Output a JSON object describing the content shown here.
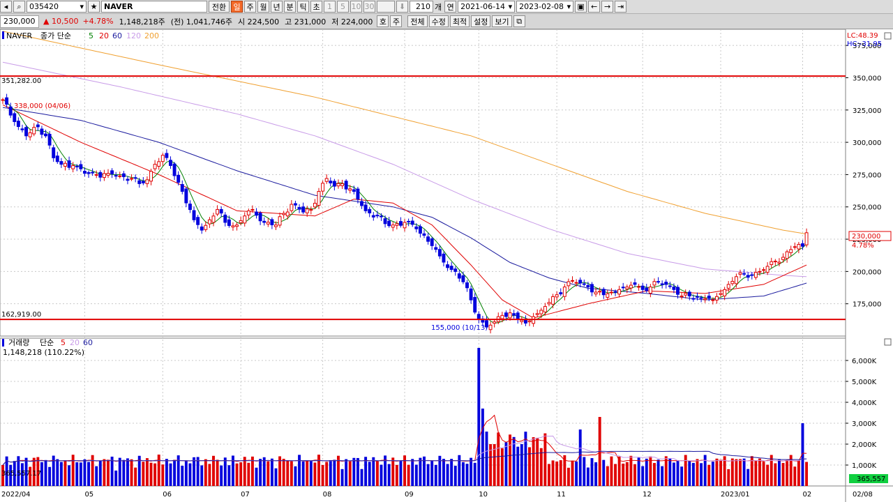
{
  "toolbar": {
    "code": "035420",
    "name": "NAVER",
    "convert_label": "전환",
    "periods": [
      "일",
      "주",
      "월",
      "년",
      "분",
      "틱",
      "초"
    ],
    "active_period": "일",
    "intervals": [
      "1",
      "5",
      "10",
      "30"
    ],
    "count": "210",
    "count_unit": "개",
    "year_label": "연",
    "start_date": "2021-06-14",
    "end_date": "2023-02-08"
  },
  "quote": {
    "price": "230,000",
    "change": "▲ 10,500",
    "change_pct": "+4.78%",
    "volume": "1,148,218주",
    "prev_volume": "(전) 1,041,746주",
    "open": "시 224,500",
    "high": "고 231,000",
    "low": "저 224,000",
    "buttons": [
      "호",
      "주",
      "전체",
      "수정",
      "최적",
      "설정",
      "보기"
    ]
  },
  "colors": {
    "up": "#e00000",
    "down": "#0000dd",
    "ma5": "#008000",
    "ma20": "#e00000",
    "ma60": "#1a1a9e",
    "ma120": "#c89be8",
    "ma200": "#f0a030",
    "hline": "#e00000"
  },
  "price_legend": {
    "name": "NAVER",
    "series": "종가 단순",
    "periods": [
      "5",
      "20",
      "60",
      "120",
      "200"
    ]
  },
  "price_info": {
    "lc": "LC:48.39",
    "hc": "HC:-31.95",
    "hline_high": "351,282.00",
    "hline_low": "162,919.00",
    "high_mark": "338,000 (04/06)",
    "low_mark": "155,000 (10/13)",
    "last_price": "230,000",
    "last_pct": "4.78%",
    "hline_high_value": 351282,
    "hline_low_value": 162919
  },
  "vol_legend": {
    "name": "거래량",
    "series": "단순",
    "periods": [
      "5",
      "20",
      "60"
    ],
    "value": "1,148,218 (110.22%)",
    "left_mark": "365,557.17",
    "last_volume": "365,557"
  },
  "chart_data": {
    "type": "candlestick",
    "price_axis": {
      "min": 150000,
      "max": 387500,
      "ticks": [
        375000,
        350000,
        325000,
        300000,
        275000,
        250000,
        225000,
        200000,
        175000
      ],
      "tick_labels": [
        "375,000",
        "350,000",
        "325,000",
        "300,000",
        "275,000",
        "250,000",
        "225,000",
        "200,000",
        "175,000"
      ]
    },
    "volume_axis": {
      "min": 0,
      "max": 6800000,
      "ticks": [
        6000000,
        5000000,
        4000000,
        3000000,
        2000000,
        1000000
      ],
      "tick_labels": [
        "6,000K",
        "5,000K",
        "4,000K",
        "3,000K",
        "2,000K",
        "1,000K"
      ]
    },
    "x_labels": [
      "2022/04",
      "05",
      "06",
      "07",
      "08",
      "09",
      "10",
      "11",
      "12",
      "2023/01",
      "02",
      "02/08"
    ],
    "x_label_days": [
      0,
      21,
      41,
      61,
      82,
      103,
      122,
      142,
      164,
      184,
      205,
      214
    ],
    "keypoints": [
      [
        0,
        333000
      ],
      [
        3,
        316000
      ],
      [
        6,
        305000
      ],
      [
        9,
        312000
      ],
      [
        11,
        305000
      ],
      [
        13,
        288000
      ],
      [
        15,
        283000
      ],
      [
        18,
        282000
      ],
      [
        21,
        276000
      ],
      [
        24,
        275000
      ],
      [
        27,
        276000
      ],
      [
        30,
        274000
      ],
      [
        33,
        272000
      ],
      [
        35,
        268000
      ],
      [
        37,
        271000
      ],
      [
        39,
        283000
      ],
      [
        41,
        290000
      ],
      [
        43,
        282000
      ],
      [
        46,
        262000
      ],
      [
        49,
        240000
      ],
      [
        51,
        232000
      ],
      [
        53,
        240000
      ],
      [
        55,
        248000
      ],
      [
        57,
        238000
      ],
      [
        60,
        236000
      ],
      [
        62,
        243000
      ],
      [
        64,
        248000
      ],
      [
        67,
        238000
      ],
      [
        70,
        236000
      ],
      [
        72,
        245000
      ],
      [
        74,
        252000
      ],
      [
        77,
        246000
      ],
      [
        79,
        248000
      ],
      [
        81,
        262000
      ],
      [
        83,
        272000
      ],
      [
        85,
        266000
      ],
      [
        87,
        268000
      ],
      [
        89,
        264000
      ],
      [
        91,
        256000
      ],
      [
        93,
        247000
      ],
      [
        96,
        243000
      ],
      [
        98,
        237000
      ],
      [
        100,
        236000
      ],
      [
        103,
        238000
      ],
      [
        106,
        233000
      ],
      [
        108,
        228000
      ],
      [
        110,
        220000
      ],
      [
        112,
        212000
      ],
      [
        114,
        203000
      ],
      [
        116,
        200000
      ],
      [
        118,
        192000
      ],
      [
        120,
        178000
      ],
      [
        122,
        163000
      ],
      [
        124,
        157000
      ],
      [
        126,
        161000
      ],
      [
        128,
        166000
      ],
      [
        130,
        168000
      ],
      [
        132,
        163000
      ],
      [
        134,
        160000
      ],
      [
        136,
        165000
      ],
      [
        138,
        170000
      ],
      [
        140,
        176000
      ],
      [
        142,
        182000
      ],
      [
        144,
        188000
      ],
      [
        146,
        193000
      ],
      [
        148,
        191000
      ],
      [
        150,
        188000
      ],
      [
        152,
        184000
      ],
      [
        154,
        182000
      ],
      [
        156,
        184000
      ],
      [
        158,
        186000
      ],
      [
        160,
        188000
      ],
      [
        162,
        190000
      ],
      [
        164,
        186000
      ],
      [
        166,
        188000
      ],
      [
        168,
        192000
      ],
      [
        170,
        190000
      ],
      [
        172,
        186000
      ],
      [
        174,
        181000
      ],
      [
        176,
        181000
      ],
      [
        178,
        180000
      ],
      [
        180,
        179000
      ],
      [
        182,
        178000
      ],
      [
        184,
        183000
      ],
      [
        186,
        190000
      ],
      [
        188,
        196000
      ],
      [
        190,
        198000
      ],
      [
        192,
        197000
      ],
      [
        194,
        200000
      ],
      [
        196,
        204000
      ],
      [
        198,
        208000
      ],
      [
        200,
        211000
      ],
      [
        202,
        217000
      ],
      [
        204,
        221000
      ],
      [
        205,
        219500
      ],
      [
        206,
        230000
      ]
    ],
    "ma_lines": {
      "ma20": [
        [
          0,
          329000
        ],
        [
          20,
          300000
        ],
        [
          40,
          275000
        ],
        [
          60,
          247000
        ],
        [
          80,
          243000
        ],
        [
          90,
          256000
        ],
        [
          100,
          253000
        ],
        [
          110,
          236000
        ],
        [
          120,
          205000
        ],
        [
          128,
          178000
        ],
        [
          136,
          164000
        ],
        [
          150,
          175000
        ],
        [
          165,
          185000
        ],
        [
          180,
          183000
        ],
        [
          195,
          190000
        ],
        [
          206,
          205000
        ]
      ],
      "ma60": [
        [
          0,
          327000
        ],
        [
          20,
          317000
        ],
        [
          40,
          300000
        ],
        [
          60,
          278000
        ],
        [
          80,
          259000
        ],
        [
          100,
          250000
        ],
        [
          110,
          242000
        ],
        [
          120,
          226000
        ],
        [
          130,
          207000
        ],
        [
          140,
          195000
        ],
        [
          150,
          187000
        ],
        [
          165,
          183000
        ],
        [
          180,
          178000
        ],
        [
          195,
          181000
        ],
        [
          206,
          191000
        ]
      ],
      "ma120": [
        [
          0,
          362000
        ],
        [
          30,
          343000
        ],
        [
          60,
          322000
        ],
        [
          80,
          305000
        ],
        [
          100,
          283000
        ],
        [
          120,
          256000
        ],
        [
          140,
          233000
        ],
        [
          160,
          214000
        ],
        [
          180,
          202000
        ],
        [
          200,
          197000
        ],
        [
          206,
          196000
        ]
      ],
      "ma200": [
        [
          0,
          386000
        ],
        [
          40,
          360000
        ],
        [
          80,
          335000
        ],
        [
          120,
          305000
        ],
        [
          160,
          262000
        ],
        [
          180,
          245000
        ],
        [
          200,
          232000
        ],
        [
          206,
          229000
        ]
      ]
    },
    "volume_spikes": [
      [
        122,
        6600000
      ],
      [
        123,
        3700000
      ],
      [
        124,
        2600000
      ],
      [
        125,
        2000000
      ],
      [
        148,
        2700000
      ],
      [
        153,
        3300000
      ],
      [
        205,
        3000000
      ],
      [
        206,
        1150000
      ],
      [
        40,
        1500000
      ]
    ]
  }
}
